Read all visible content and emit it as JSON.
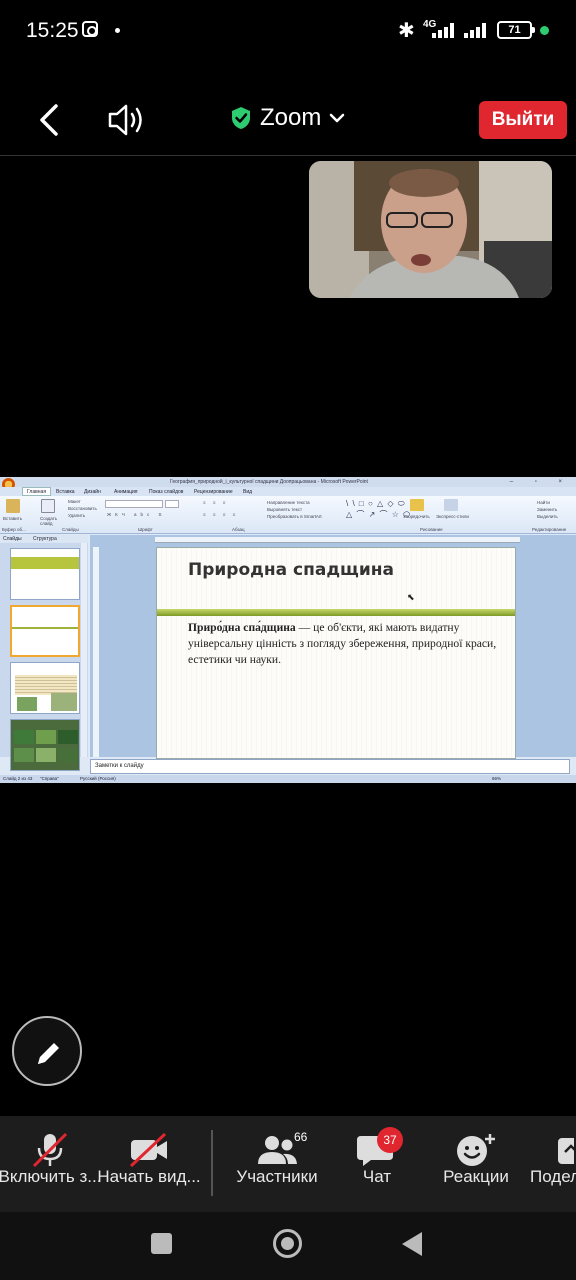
{
  "status_bar": {
    "time": "15:25",
    "network": "4G",
    "battery": "71",
    "icons": [
      "instagram-icon",
      "bluetooth-icon",
      "signal-icon",
      "battery-icon"
    ]
  },
  "top_bar": {
    "title": "Zoom",
    "exit_label": "Выйти",
    "exit_color": "#e0262f",
    "secure_color": "#2ecc71"
  },
  "shared_screen": {
    "window_title": "География_природной_i_культурної спадщини Доопрацьована - Microsoft PowerPoint",
    "ribbon_tabs": [
      "Главная",
      "Вставка",
      "Дизайн",
      "Анимация",
      "Показ слайдов",
      "Рецензирование",
      "Вид"
    ],
    "ribbon_labels": {
      "paste": "Вставить",
      "create_slide": "Создать слайд",
      "layout": "Макет",
      "restore": "Восстановить",
      "delete": "Удалить",
      "text_direction": "Направление текста",
      "align_text": "Выровнять текст",
      "smartart": "Преобразовать в SmartArt",
      "arrange": "Упорядочить",
      "quick_styles": "Экспресс-стили",
      "find": "Найти",
      "replace": "Заменить",
      "select": "Выделить",
      "group_clipboard": "Буфер об...",
      "group_slides": "Слайды",
      "group_font": "Шрифт",
      "group_paragraph": "Абзац",
      "group_drawing": "Рисование",
      "group_editing": "Редактирование"
    },
    "panel_tabs": [
      "Слайды",
      "Структура"
    ],
    "slide": {
      "title": "Природна спадщина",
      "term": "Приро́дна спа́дщина",
      "body": " — це об'єкти, які мають видатну універсальну цінність з погляду збереження, природної краси, естетики чи науки."
    },
    "notes_placeholder": "Заметки к слайду",
    "status": {
      "slide_of": "Слайд 2 из 43",
      "theme": "\"Справа\"",
      "language": "Русский (Россия)",
      "zoom": "66%"
    }
  },
  "toolbar": {
    "items": [
      {
        "label": "Включить з..."
      },
      {
        "label": "Начать вид..."
      },
      {
        "label": "Участники",
        "count": "66"
      },
      {
        "label": "Чат",
        "badge": "37"
      },
      {
        "label": "Реакции"
      },
      {
        "label": "Подел"
      }
    ]
  }
}
